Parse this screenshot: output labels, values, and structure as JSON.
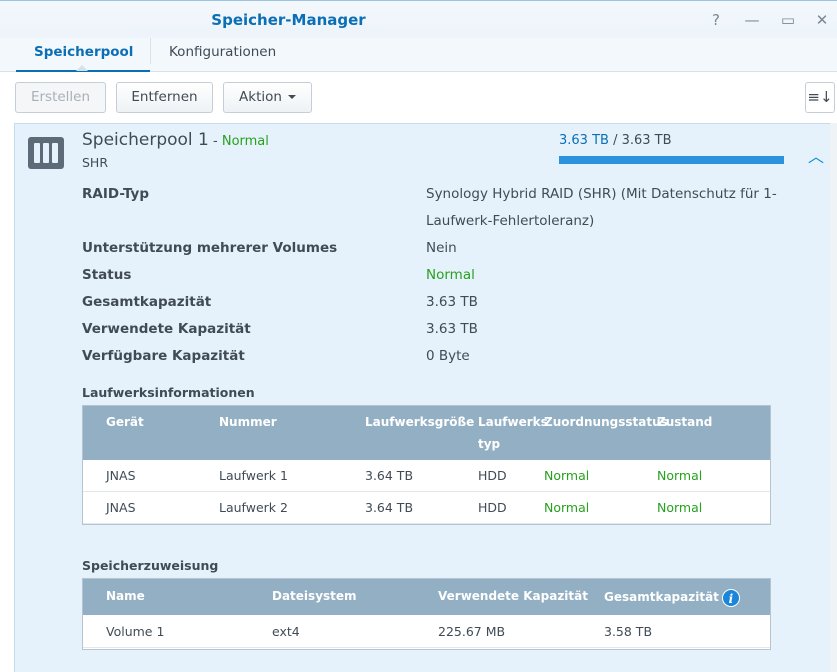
{
  "window": {
    "title": "Speicher-Manager",
    "controls": [
      "?",
      "—",
      "▭",
      "✕"
    ]
  },
  "tabs": [
    {
      "label": "Speicherpool"
    },
    {
      "label": "Konfigurationen"
    }
  ],
  "toolbar": {
    "create_label": "Erstellen",
    "remove_label": "Entfernen",
    "action_label": "Aktion",
    "sort_icon": "sort-icon"
  },
  "pool": {
    "name": "Speicherpool 1",
    "dash": " - ",
    "status": "Normal",
    "type": "SHR",
    "used": "3.63 TB",
    "total_sep": " / ",
    "total": "3.63 TB",
    "usage_fraction": 1.0,
    "icon": "storage-pool-icon"
  },
  "properties": [
    {
      "label": "RAID-Typ",
      "value": "Synology Hybrid RAID (SHR) (Mit Datenschutz für 1-Laufwerk-Fehlertoleranz)"
    },
    {
      "label": "Unterstützung mehrerer Volumes",
      "value": "Nein"
    },
    {
      "label": "Status",
      "value": "Normal"
    },
    {
      "label": "Gesamtkapazität",
      "value": "3.63 TB"
    },
    {
      "label": "Verwendete Kapazität",
      "value": "3.63 TB"
    },
    {
      "label": "Verfügbare Kapazität",
      "value": "0 Byte"
    }
  ],
  "drives": {
    "title": "Laufwerksinformationen",
    "headers": [
      "Gerät",
      "Nummer",
      "Laufwerksgröße",
      "Laufwerks typ",
      "Zuordnungsstatus",
      "Zustand"
    ],
    "rows": [
      [
        "JNAS",
        "Laufwerk 1",
        "3.64 TB",
        "HDD",
        "Normal",
        "Normal"
      ],
      [
        "JNAS",
        "Laufwerk 2",
        "3.64 TB",
        "HDD",
        "Normal",
        "Normal"
      ]
    ]
  },
  "allocation": {
    "title": "Speicherzuweisung",
    "headers": [
      "Name",
      "Dateisystem",
      "Verwendete Kapazität",
      "Gesamtkapazität"
    ],
    "rows": [
      [
        "Volume 1",
        "ext4",
        "225.67 MB",
        "3.58 TB"
      ]
    ]
  },
  "colors": {
    "accent": "#0a6fb5",
    "status_green": "#27a11e",
    "panel_bg": "#e6f2fb",
    "grid_header": "#93afc3"
  }
}
